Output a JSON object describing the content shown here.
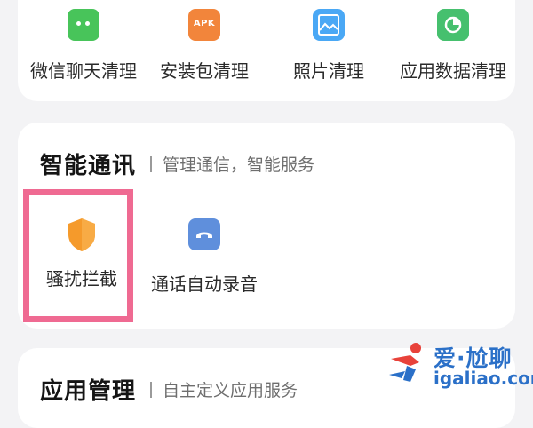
{
  "cleanup": {
    "items": [
      {
        "label": "微信聊天清理",
        "icon": "wechat-icon"
      },
      {
        "label": "安装包清理",
        "icon": "apk-icon",
        "icon_text": "APK"
      },
      {
        "label": "照片清理",
        "icon": "photo-icon"
      },
      {
        "label": "应用数据清理",
        "icon": "pie-chart-icon"
      }
    ]
  },
  "smart_comm": {
    "title": "智能通讯",
    "subtitle": "管理通信，智能服务",
    "items": [
      {
        "label": "骚扰拦截",
        "icon": "shield-icon",
        "highlighted": true
      },
      {
        "label": "通话自动录音",
        "icon": "call-record-icon"
      }
    ]
  },
  "app_mgmt": {
    "title": "应用管理",
    "subtitle": "自主定义应用服务"
  },
  "watermark": {
    "line1": "爱·尬聊",
    "line2": "igaliao.com"
  },
  "colors": {
    "highlight_border": "#ef6a92",
    "shield": "#f59a2b",
    "record": "#5f8fdc",
    "watermark": "#2b70c8"
  }
}
